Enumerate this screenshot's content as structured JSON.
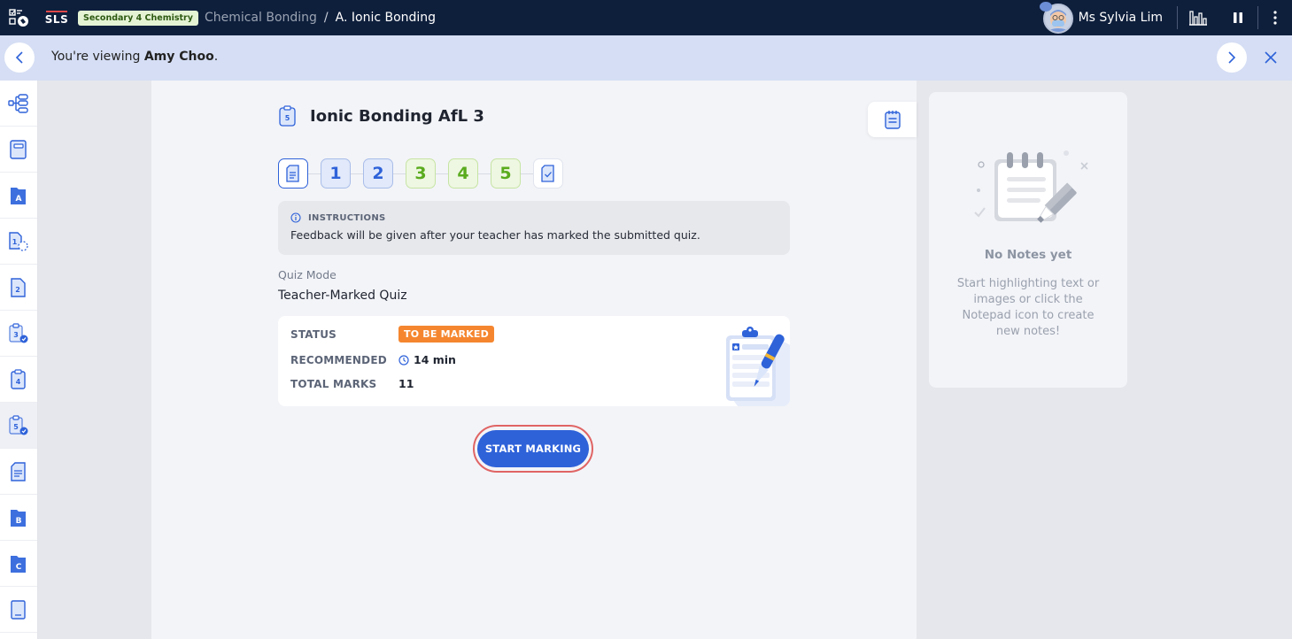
{
  "topbar": {
    "logo": "SLS",
    "subject_badge": "Secondary 4 Chemistry",
    "breadcrumb": [
      "Chemical Bonding",
      "A. Ionic Bonding"
    ],
    "breadcrumb_separator": "/",
    "user_name": "Ms Sylvia Lim",
    "icons": [
      "apps-grid-icon",
      "stats-bar-chart-icon",
      "pause-icon",
      "more-vertical-icon"
    ]
  },
  "viewing_bar": {
    "prefix": "You're viewing ",
    "student": "Amy Choo",
    "suffix": "."
  },
  "sidebar": {
    "items": [
      {
        "icon": "lesson-map-icon"
      },
      {
        "icon": "notebook-icon"
      },
      {
        "icon": "folder-a-icon",
        "letter": "A"
      },
      {
        "icon": "page-1-in-progress-icon",
        "number": "1"
      },
      {
        "icon": "page-2-icon",
        "number": "2"
      },
      {
        "icon": "quiz-3-submitted-icon",
        "number": "3"
      },
      {
        "icon": "quiz-4-icon",
        "number": "4"
      },
      {
        "icon": "quiz-5-submitted-icon",
        "number": "5",
        "active": true
      },
      {
        "icon": "document-icon"
      },
      {
        "icon": "folder-b-icon",
        "letter": "B"
      },
      {
        "icon": "folder-c-icon",
        "letter": "C"
      },
      {
        "icon": "book-icon"
      }
    ]
  },
  "quiz": {
    "icon_number": "5",
    "title": "Ionic Bonding AfL 3",
    "steps": [
      {
        "type": "doc"
      },
      {
        "label": "1",
        "state": "blue"
      },
      {
        "label": "2",
        "state": "blue"
      },
      {
        "label": "3",
        "state": "green"
      },
      {
        "label": "4",
        "state": "green"
      },
      {
        "label": "5",
        "state": "green"
      },
      {
        "type": "done"
      }
    ],
    "instructions": {
      "heading": "INSTRUCTIONS",
      "text": "Feedback will be given after your teacher has marked the submitted quiz."
    },
    "quiz_mode_label": "Quiz Mode",
    "quiz_mode_value": "Teacher-Marked Quiz",
    "info": {
      "status_label": "STATUS",
      "status_value": "TO BE MARKED",
      "recommended_label": "RECOMMENDED",
      "recommended_value": "14 min",
      "total_marks_label": "TOTAL MARKS",
      "total_marks_value": "11"
    },
    "start_button": "START MARKING"
  },
  "notes": {
    "title": "No Notes yet",
    "body": "Start highlighting text or images or click the Notepad icon to create new notes!"
  },
  "colors": {
    "navbar": "#0e1f3c",
    "accent": "#2e62d9",
    "status_orange": "#f5862f",
    "highlight_ring": "#e06464",
    "green_step": "#5aab1e"
  }
}
